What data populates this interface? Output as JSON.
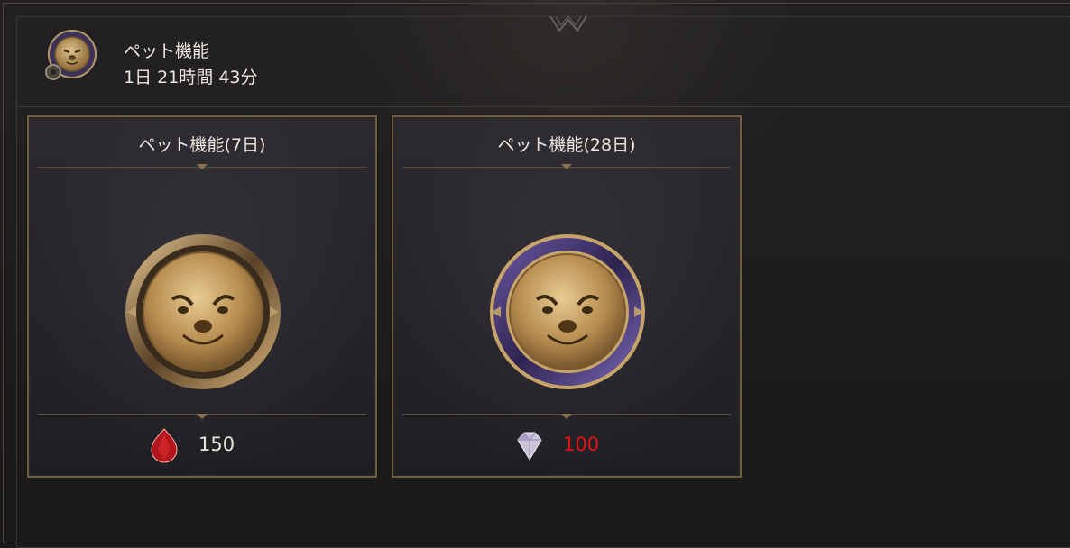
{
  "header": {
    "title": "ペット機能",
    "remaining_time": "1日 21時間 43分",
    "icon": "pet-medal-icon"
  },
  "cards": [
    {
      "title": "ペット機能(7日)",
      "medal_ring": "bronze",
      "price_icon": "red-gem-icon",
      "price": "150",
      "price_color": "#e8e4dc"
    },
    {
      "title": "ペット機能(28日)",
      "medal_ring": "purple",
      "price_icon": "diamond-icon",
      "price": "100",
      "price_color": "#e11414"
    }
  ],
  "colors": {
    "background": "#1b1a1a",
    "card_border": "#6e5c45",
    "gold": "#c9a46a",
    "purple_ring": "#5a4a86",
    "insufficient_red": "#e11414"
  }
}
